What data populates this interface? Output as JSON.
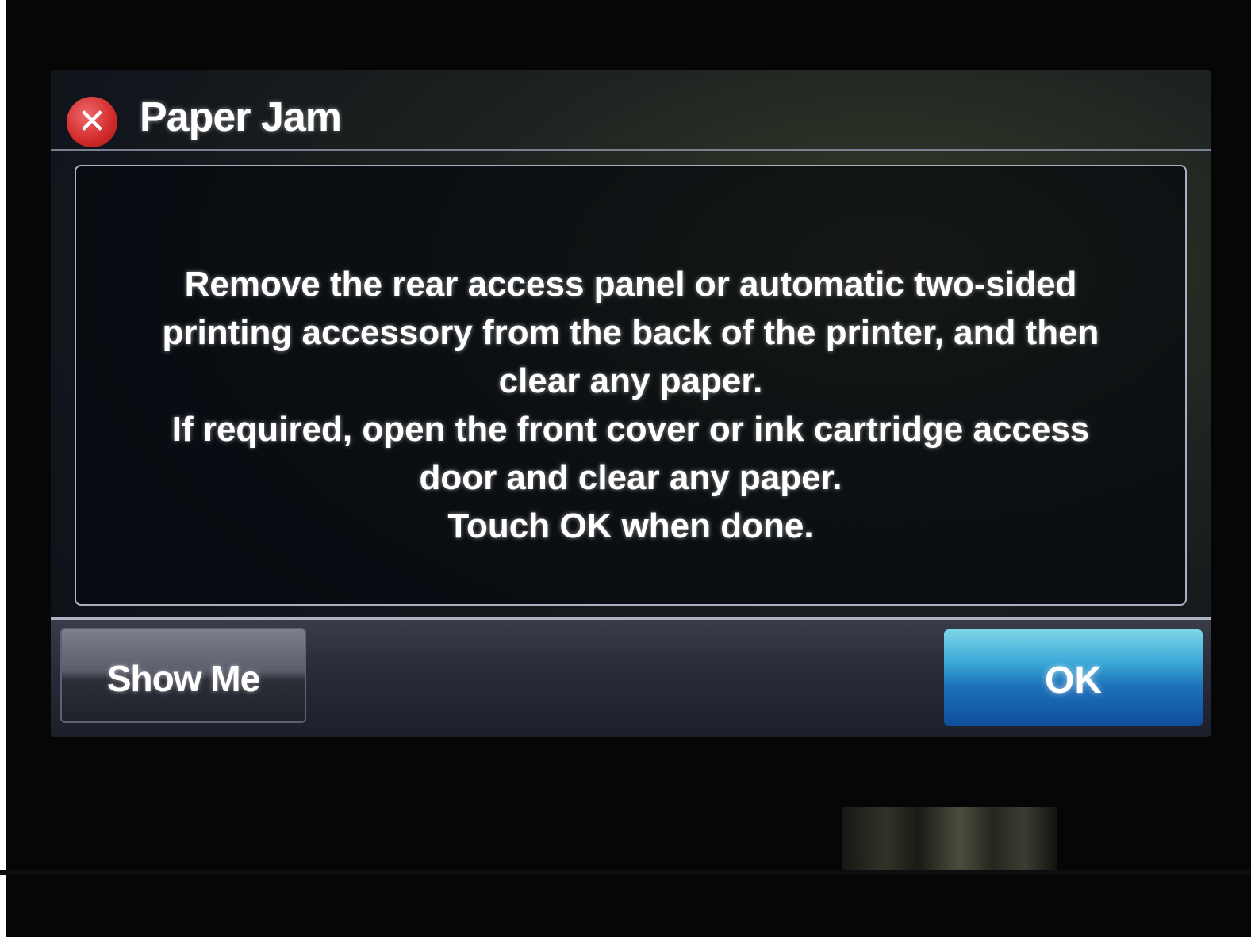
{
  "dialog": {
    "title": "Paper Jam",
    "icon": "error-x-icon",
    "message": "Remove the rear access panel or automatic two-sided\nprinting accessory from the back of the printer, and then\nclear any paper.\nIf required, open the front cover or ink cartridge access\ndoor and clear any paper.\nTouch OK when done."
  },
  "buttons": {
    "show_me_label": "Show Me",
    "ok_label": "OK"
  },
  "colors": {
    "error_icon": "#d02a2a",
    "ok_button": "#1c6fb8",
    "text": "#ffffff"
  }
}
